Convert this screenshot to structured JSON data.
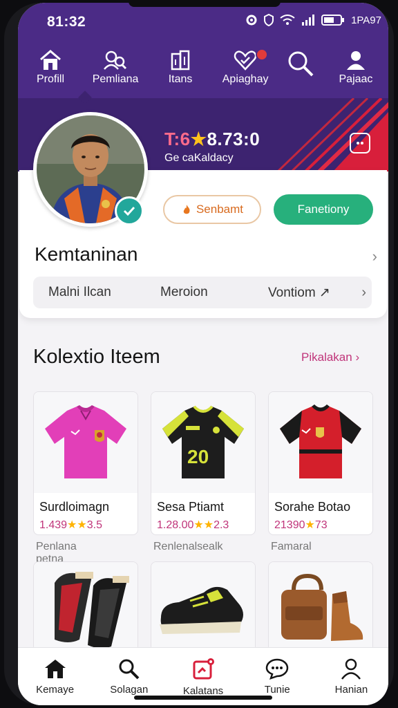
{
  "status_bar": {
    "time": "81:32",
    "battery": "1PA97"
  },
  "top_nav": {
    "items": [
      {
        "label": "Profill",
        "icon": "home-icon"
      },
      {
        "label": "Pemliana",
        "icon": "users-search-icon"
      },
      {
        "label": "Itans",
        "icon": "items-icon"
      },
      {
        "label": "Apiaghay",
        "icon": "heart-icon"
      },
      {
        "label": "Pajaac",
        "icon": "user-icon"
      }
    ],
    "search_icon": "search-icon",
    "active_index": 0
  },
  "banner": {
    "score_part1": "T:6",
    "score_star": "★",
    "score_part2": "8.73:0",
    "subtitle": "Ge caKaldacy",
    "colors": {
      "bg": "#3d2370",
      "stripe": "#d81f3b"
    }
  },
  "profile": {
    "follow_button": "Senbamt",
    "primary_button": "Fanetiony",
    "section_title": "Kemtaninan",
    "pills": [
      "Malni Ilcan",
      "Meroion",
      "Vontiom ↗"
    ],
    "verified_icon": "check-icon"
  },
  "collection": {
    "title": "Kolextio Iteem",
    "link": "Pikalakan",
    "products": [
      {
        "name": "Surdloimagn",
        "price_a": "1.439",
        "price_b": "3.5",
        "sub": "Penlana petna",
        "icon": "pink-jersey"
      },
      {
        "name": "Sesa Ptiamt",
        "price_a": "1.28.00",
        "price_b": "2.3",
        "sub": "Renlenalsealk",
        "icon": "black-yellow-jersey"
      },
      {
        "name": "Sorahe Botao",
        "price_a": "21390",
        "price_b": "73",
        "sub": "Famaral",
        "icon": "red-black-jersey"
      }
    ],
    "row2": [
      {
        "icon": "shin-guards"
      },
      {
        "icon": "football-boot"
      },
      {
        "icon": "leather-bags"
      }
    ]
  },
  "bottom_nav": {
    "items": [
      {
        "label": "Kemaye",
        "icon": "home-icon"
      },
      {
        "label": "Solagan",
        "icon": "search-icon"
      },
      {
        "label": "Kalatans",
        "icon": "tag-icon"
      },
      {
        "label": "Tunie",
        "icon": "chat-icon"
      },
      {
        "label": "Hanian",
        "icon": "user-icon"
      }
    ]
  },
  "colors": {
    "primary": "#4b2b86",
    "accent_green": "#27b07c",
    "accent_pink": "#c0347a"
  }
}
